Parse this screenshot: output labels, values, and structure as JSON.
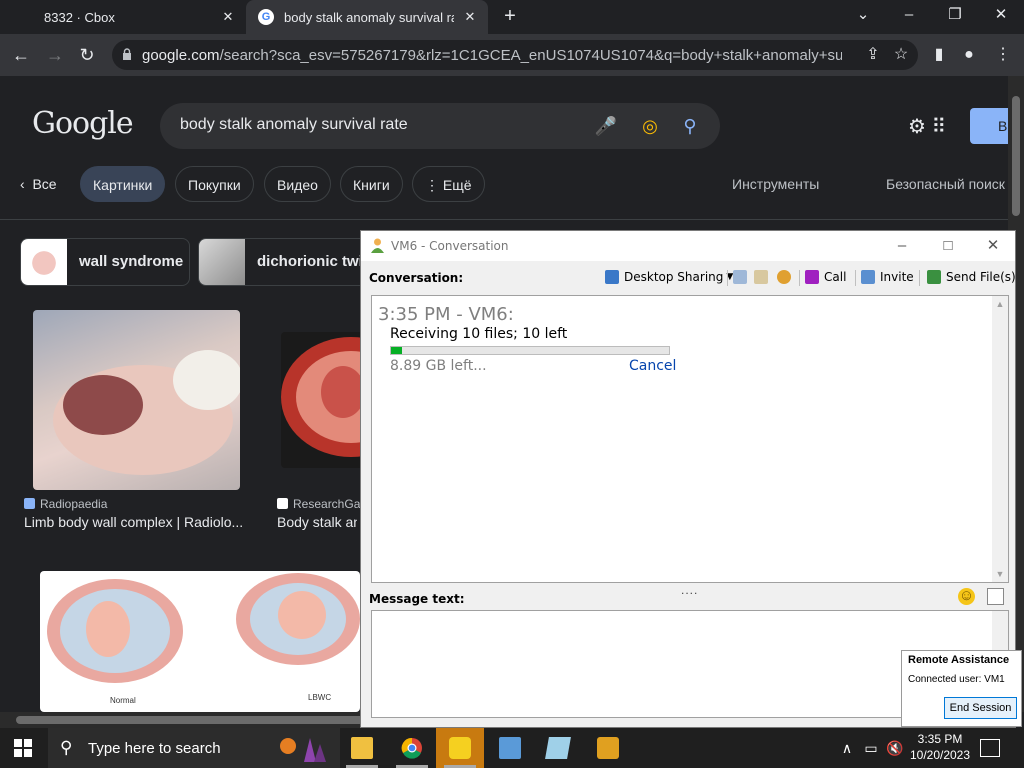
{
  "browser": {
    "tabs": [
      {
        "label": "8332 · Cbox"
      },
      {
        "label": "body stalk anomaly survival rate"
      }
    ],
    "url_host": "google.com",
    "url_rest": "/search?sca_esv=575267179&rlz=1C1GCEA_enUS1074US1074&q=body+stalk+anomaly+survival+ra..."
  },
  "google": {
    "logo": "Google",
    "query": "body stalk anomaly survival rate",
    "signin_partial": "В",
    "tabs": {
      "all": "Все",
      "images": "Картинки",
      "shopping": "Покупки",
      "video": "Видео",
      "books": "Книги",
      "more": "Ещё",
      "tools": "Инструменты",
      "safesearch": "Безопасный поиск"
    },
    "chips": [
      "wall syndrome",
      "dichorionic twin"
    ],
    "results": [
      {
        "source": "Radiopaedia",
        "title": "Limb body wall complex | Radiolo..."
      },
      {
        "source": "ResearchGate",
        "title": "Body stalk an"
      }
    ],
    "diagram_labels": [
      "Normal",
      "LBWC"
    ]
  },
  "conversation": {
    "title": "VM6 - Conversation",
    "label": "Conversation:",
    "toolbar": {
      "desktop_sharing": "Desktop Sharing",
      "call": "Call",
      "invite": "Invite",
      "send_files": "Send File(s)"
    },
    "timestamp_line": "3:35 PM - VM6:",
    "receiving": "Receiving 10 files; 10 left",
    "progress_fraction": 0.04,
    "size_left": "8.89 GB left...",
    "cancel": "Cancel",
    "message_label": "Message text:",
    "grip": "...."
  },
  "remote_assistance": {
    "title": "Remote Assistance",
    "connected": "Connected user:  VM1",
    "end_session": "End Session"
  },
  "taskbar": {
    "search_placeholder": "Type here to search",
    "time": "3:35 PM",
    "date": "10/20/2023"
  },
  "colors": {
    "progress": "#06b025",
    "link": "#0645ad",
    "google_bg": "#202124"
  }
}
